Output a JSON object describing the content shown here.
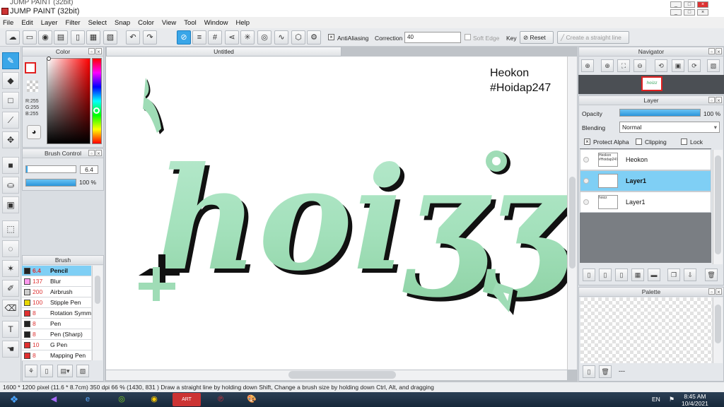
{
  "window": {
    "ghost_title": "JUMP PAINT (32bit)",
    "title": "JUMP PAINT (32bit)"
  },
  "menu": [
    "File",
    "Edit",
    "Layer",
    "Filter",
    "Select",
    "Snap",
    "Color",
    "View",
    "Tool",
    "Window",
    "Help"
  ],
  "toolbar": {
    "antialiasing_label": "AntiAliasing",
    "correction_label": "Correction",
    "correction_value": "40",
    "soft_edge_label": "Soft Edge",
    "key_label": "Key",
    "reset_label": "Reset",
    "straight_line_label": "Create a straight line"
  },
  "color_panel": {
    "title": "Color",
    "r": "R:255",
    "g": "G:255",
    "b": "B:255",
    "primary_color": "#ffffff",
    "border_color": "#e02020"
  },
  "brush_control": {
    "title": "Brush Control",
    "size_value": "6.4",
    "opacity_value": "100 %",
    "size_fraction": 0.03,
    "opacity_fraction": 1.0
  },
  "brush_panel": {
    "title": "Brush",
    "items": [
      {
        "size": "6.4",
        "name": "Pencil",
        "color": "#222222",
        "selected": true
      },
      {
        "size": "137",
        "name": "Blur",
        "color": "#ff99ee",
        "selected": false
      },
      {
        "size": "200",
        "name": "Airbrush",
        "color": "#cccccc",
        "selected": false
      },
      {
        "size": "100",
        "name": "Stipple Pen",
        "color": "#e8d800",
        "selected": false
      },
      {
        "size": "8",
        "name": "Rotation Symm",
        "color": "#e03030",
        "selected": false
      },
      {
        "size": "8",
        "name": "Pen",
        "color": "#222222",
        "selected": false
      },
      {
        "size": "8",
        "name": "Pen (Sharp)",
        "color": "#222222",
        "selected": false
      },
      {
        "size": "10",
        "name": "G Pen",
        "color": "#e03030",
        "selected": false
      },
      {
        "size": "8",
        "name": "Mapping Pen",
        "color": "#e03030",
        "selected": false
      }
    ]
  },
  "document": {
    "tab_title": "Untitled",
    "watermark_line1": "Heokon",
    "watermark_line2": "#Hoidap247",
    "art_text": "hoiʒʒ",
    "art_fill": "#9fdcb6",
    "art_shadow": "#111111"
  },
  "navigator": {
    "title": "Navigator",
    "thumb_text": "hoizz"
  },
  "layer_panel": {
    "title": "Layer",
    "opacity_label": "Opacity",
    "opacity_value": "100 %",
    "opacity_fraction": 1.0,
    "blending_label": "Blending",
    "blending_value": "Normal",
    "protect_alpha_label": "Protect Alpha",
    "clipping_label": "Clipping",
    "lock_label": "Lock",
    "layers": [
      {
        "name": "Heokon",
        "thumb": "Heokon #Hoidap247",
        "selected": false
      },
      {
        "name": "Layer1",
        "thumb": "",
        "selected": true
      },
      {
        "name": "Layer1",
        "thumb": "hoizz",
        "selected": false
      }
    ]
  },
  "palette_panel": {
    "title": "Palette",
    "footer_text": "---"
  },
  "status": {
    "text": "1600 * 1200 pixel   (11.6 * 8.7cm)  350 dpi   66 %   (1430, 831 )   Draw a straight line by holding down Shift, Change a brush size by holding down Ctrl, Alt, and dragging"
  },
  "taskbar": {
    "lang": "EN",
    "time": "8:45 AM",
    "date": "10/4/2021"
  }
}
